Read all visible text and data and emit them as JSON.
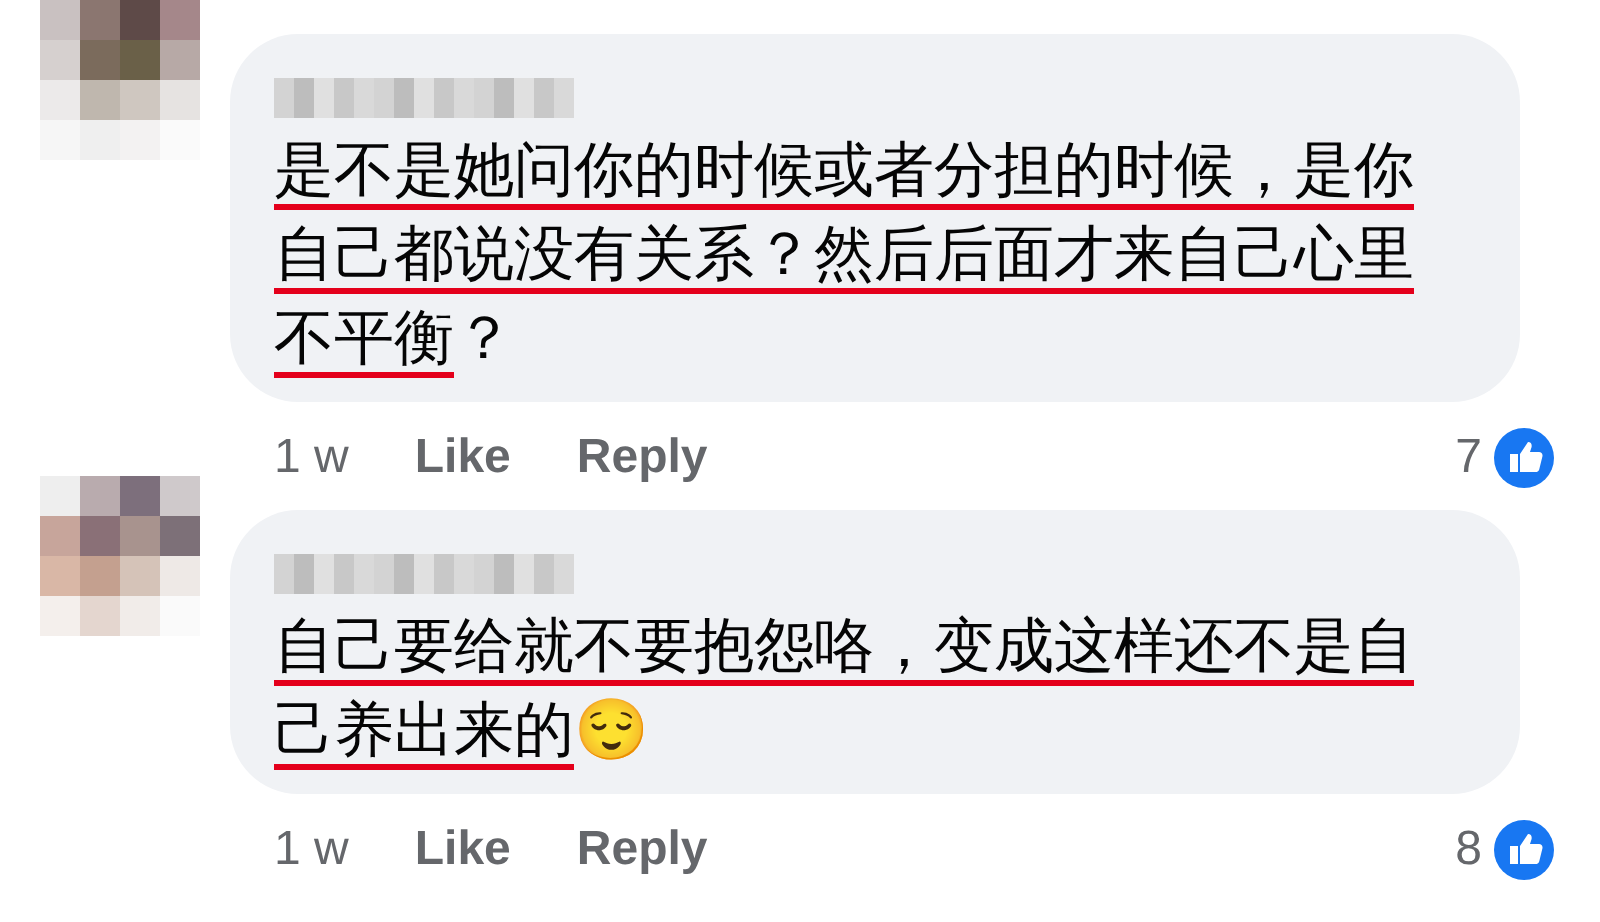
{
  "comments": [
    {
      "segments": [
        {
          "text": "是不是她问你的时候或者分担的时候，是你自己都说没有关系？然后后面才来自己心里不平衡",
          "underlined": true
        },
        {
          "text": "？",
          "underlined": false
        }
      ],
      "time": "1 w",
      "actions": [
        "Like",
        "Reply"
      ],
      "reactions": "7"
    },
    {
      "segments": [
        {
          "text": "自己要给就不要抱怨咯，变成这样还不是自己养出来的",
          "underlined": true
        },
        {
          "text": "😌",
          "underlined": false
        }
      ],
      "time": "1 w",
      "actions": [
        "Like",
        "Reply"
      ],
      "reactions": "8"
    }
  ]
}
